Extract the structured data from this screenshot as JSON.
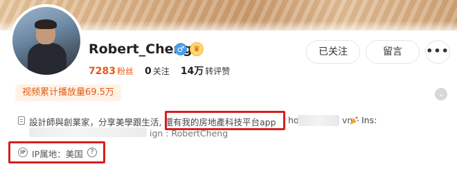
{
  "profile": {
    "name": "Robert_Cheng",
    "gender_icon": "male-icon",
    "vip_icon": "crown-badge-icon"
  },
  "stats": {
    "fans_count": "7283",
    "fans_label": "粉丝",
    "following_count": "0",
    "following_label": "关注",
    "likes_count": "14万",
    "likes_label": "转评赞"
  },
  "actions": {
    "follow_label": "已关注",
    "message_label": "留言",
    "more_label": "•••"
  },
  "video_stats": {
    "label": "视频累计播放量69.5万"
  },
  "bio": {
    "line1_prefix": "設計師與創業家，分享美學跟生活,",
    "line1_highlight": "還有我的房地產科技平台app",
    "line1_fragment1": "ho",
    "line1_fragment2": "vn",
    "ins_label": "Ins:",
    "line2_visible": "ign      : RobertCheng"
  },
  "ip": {
    "label": "IP属地：美国",
    "icon_text": "IP",
    "help_icon_text": "?"
  },
  "colors": {
    "accent_orange": "#e05a17",
    "annotation_red": "#d81e1e"
  }
}
